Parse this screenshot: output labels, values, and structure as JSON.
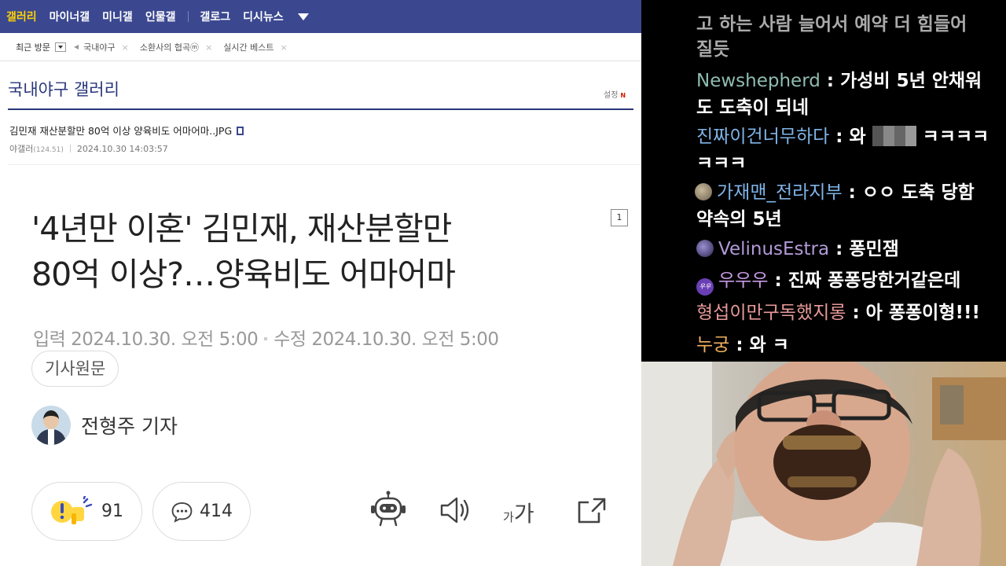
{
  "gnb": {
    "items": [
      "갤러리",
      "마이너갤",
      "미니갤",
      "인물갤"
    ],
    "items2": [
      "갤로그",
      "디시뉴스"
    ]
  },
  "visit": {
    "label": "최근 방문",
    "chips": [
      "국내야구",
      "소환사의 협곡ⓜ",
      "실시간 베스트"
    ]
  },
  "gallery": {
    "title": "국내야구 갤러리",
    "settings": "설정",
    "new_mark": "N"
  },
  "post": {
    "title": "김민재 재산분할만 80억 이상 양육비도 어마어마..JPG",
    "author": "야갤러",
    "ip": "(124.51)",
    "datetime": "2024.10.30 14:03:57"
  },
  "article": {
    "headline_1": "'4년만 이혼' 김민재, 재산분할만",
    "headline_2": "80억 이상?…양육비도 어마어마",
    "page_number": "1",
    "input_date": "입력 2024.10.30. 오전 5:00",
    "edit_date": "수정 2024.10.30. 오전 5:00",
    "original_button": "기사원문",
    "reporter": "전형주 기자",
    "reaction_count": "91",
    "comment_count": "414",
    "font_label_small": "가",
    "font_label_big": "가"
  },
  "chat": {
    "partial_top_1": "고 하는 사람 늘어서 예약 더 힘들어",
    "partial_top_2": "질듯",
    "messages": [
      {
        "nick": "Newshepherd",
        "sep": " : ",
        "text": "가성비 5년 안채워",
        "cont": "도 도축이 되네",
        "color": "#8fbcb0"
      },
      {
        "nick": "진짜이건너무하다",
        "sep": " : ",
        "text": "와 ",
        "text2": " ㅋㅋㅋㅋ",
        "cont": "ㅋㅋㅋ",
        "color": "#7fb4e8"
      },
      {
        "nick": "가재맨_전라지부",
        "sep": " : ",
        "text": "ㅇㅇ 도축 당함",
        "cont": "약속의 5년",
        "color": "#7fb4e8"
      },
      {
        "nick": "VelinusEstra",
        "sep": " : ",
        "text": "퐁민잼",
        "color": "#b39ad8"
      },
      {
        "nick": "우우우",
        "sep": " : ",
        "text": "진짜 퐁퐁당한거같은데",
        "color": "#c49ae0"
      },
      {
        "nick": "형섭이만구독했지롱",
        "sep": " : ",
        "text": "아 퐁퐁이형!!!",
        "color": "#e89a9a"
      },
      {
        "nick": "누궁",
        "sep": " : ",
        "text": "와 ㅋ",
        "color": "#f0b060"
      }
    ],
    "badge_text": "우우"
  },
  "colors": {
    "gnb_bg": "#3b4890",
    "gallery_title": "#29367c",
    "chat_bg": "#000000"
  }
}
